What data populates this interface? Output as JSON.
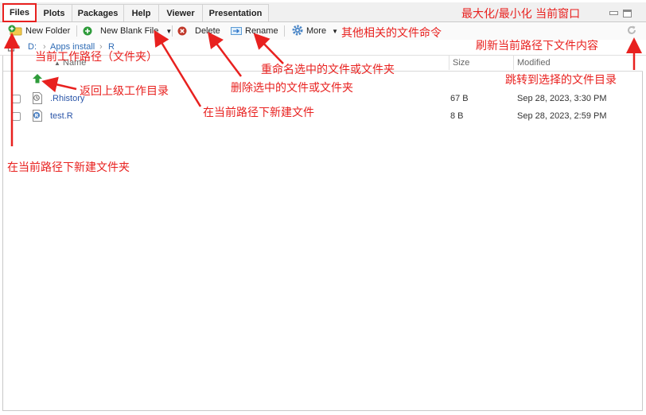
{
  "tabs": [
    {
      "label": "Files"
    },
    {
      "label": "Plots"
    },
    {
      "label": "Packages"
    },
    {
      "label": "Help"
    },
    {
      "label": "Viewer"
    },
    {
      "label": "Presentation"
    }
  ],
  "toolbar": {
    "new_folder": "New Folder",
    "new_blank_file": "New Blank File",
    "delete": "Delete",
    "rename": "Rename",
    "more": "More"
  },
  "breadcrumb": {
    "items": [
      "D:",
      "Apps install",
      "R"
    ]
  },
  "columns": {
    "name": "Name",
    "size": "Size",
    "modified": "Modified"
  },
  "files": [
    {
      "name": ".Rhistory",
      "size": "67 B",
      "modified": "Sep 28, 2023, 3:30 PM",
      "icon": "history-file-icon"
    },
    {
      "name": "test.R",
      "size": "8 B",
      "modified": "Sep 28, 2023, 2:59 PM",
      "icon": "r-script-icon"
    }
  ],
  "annotations": {
    "maximize": "最大化/最小化 当前窗口",
    "more_cmds": "其他相关的文件命令",
    "refresh": "刷新当前路径下文件内容",
    "current_path": "当前工作路径（文件夹）",
    "rename": "重命名选中的文件或文件夹",
    "go_up": "返回上级工作目录",
    "delete": "删除选中的文件或文件夹",
    "jump": "跳转到选择的文件目录",
    "new_file": "在当前路径下新建文件",
    "new_folder": "在当前路径下新建文件夹"
  },
  "colors": {
    "annotation": "#e8211f",
    "link": "#2a55a8",
    "active_tab_border": "#e8211f"
  }
}
